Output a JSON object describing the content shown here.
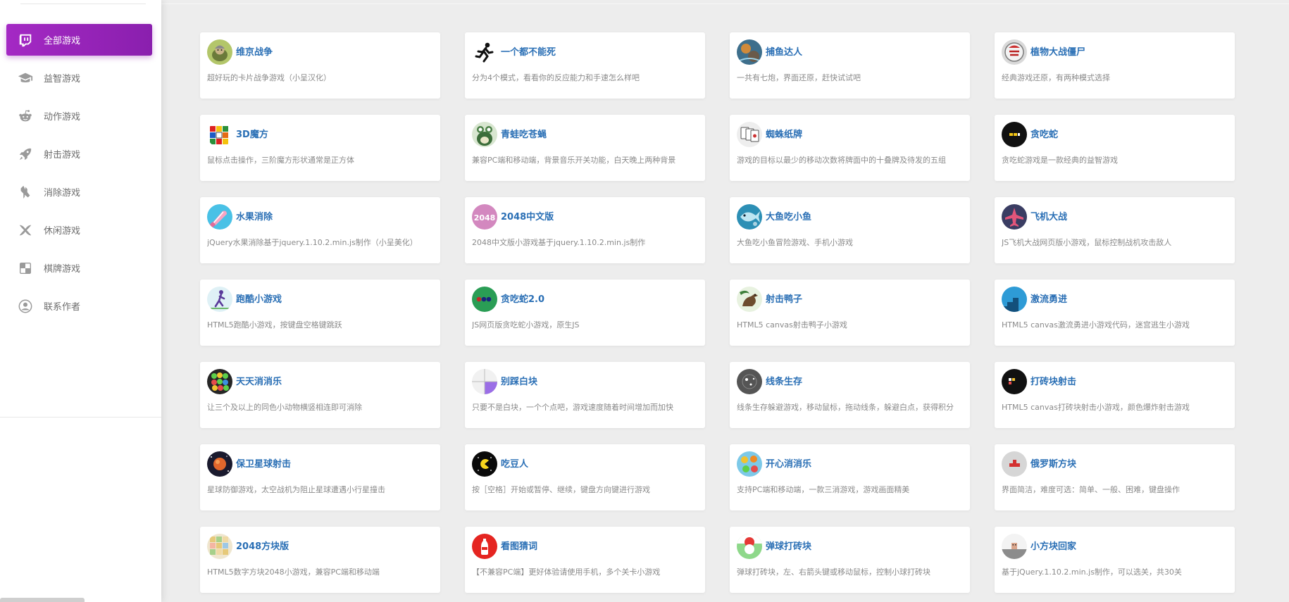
{
  "sidebar": {
    "items": [
      {
        "label": "全部游戏",
        "icon": "twitch-icon",
        "active": true
      },
      {
        "label": "益智游戏",
        "icon": "graduation-cap-icon",
        "active": false
      },
      {
        "label": "动作游戏",
        "icon": "reddit-icon",
        "active": false
      },
      {
        "label": "射击游戏",
        "icon": "rocket-icon",
        "active": false
      },
      {
        "label": "消除游戏",
        "icon": "lightning-icon",
        "active": false
      },
      {
        "label": "休闲游戏",
        "icon": "xbox-icon",
        "active": false
      },
      {
        "label": "棋牌游戏",
        "icon": "checkerboard-icon",
        "active": false
      },
      {
        "label": "联系作者",
        "icon": "user-circle-icon",
        "active": false
      }
    ],
    "accent_color": "#9b25bd"
  },
  "games": [
    {
      "title": "维京战争",
      "desc": "超好玩的卡片战争游戏（小呈汉化）",
      "icon": "viking-war-icon"
    },
    {
      "title": "一个都不能死",
      "desc": "分为4个模式，看看你的反应能力和手速怎么样吧",
      "icon": "running-man-icon"
    },
    {
      "title": "捕鱼达人",
      "desc": "一共有七炮，界面还原，赶快试试吧",
      "icon": "fishing-icon"
    },
    {
      "title": "植物大战僵尸",
      "desc": "经典游戏还原，有两种模式选择",
      "icon": "popcap-icon"
    },
    {
      "title": "3D魔方",
      "desc": "鼠标点击操作，三阶魔方形状通常是正方体",
      "icon": "rubiks-cube-icon"
    },
    {
      "title": "青蛙吃苍蝇",
      "desc": "兼容PC端和移动端，背景音乐开关功能，白天晚上两种背景",
      "icon": "frog-icon"
    },
    {
      "title": "蜘蛛纸牌",
      "desc": "游戏的目标以最少的移动次数将牌面中的十叠牌及待发的五组",
      "icon": "playing-cards-icon"
    },
    {
      "title": "贪吃蛇",
      "desc": "贪吃蛇游戏是一款经典的益智游戏",
      "icon": "snake-icon"
    },
    {
      "title": "水果消除",
      "desc": "jQuery水果消除基于jquery.1.10.2.min.js制作（小呈美化）",
      "icon": "fruit-icon"
    },
    {
      "title": "2048中文版",
      "desc": "2048中文版小游戏基于jquery.1.10.2.min.js制作",
      "icon": "game-2048-icon"
    },
    {
      "title": "大鱼吃小鱼",
      "desc": "大鱼吃小鱼冒险游戏、手机小游戏",
      "icon": "big-fish-icon"
    },
    {
      "title": "飞机大战",
      "desc": "JS飞机大战网页版小游戏，鼠标控制战机攻击敌人",
      "icon": "plane-icon"
    },
    {
      "title": "跑酷小游戏",
      "desc": "HTML5跑酷小游戏，按键盘空格键跳跃",
      "icon": "parkour-icon"
    },
    {
      "title": "贪吃蛇2.0",
      "desc": "JS网页版贪吃蛇小游戏，原生JS",
      "icon": "snake-dots-icon"
    },
    {
      "title": "射击鸭子",
      "desc": "HTML5 canvas射击鸭子小游戏",
      "icon": "duck-icon"
    },
    {
      "title": "激流勇进",
      "desc": "HTML5 canvas激流勇进小游戏代码，迷宫逃生小游戏",
      "icon": "stairs-icon"
    },
    {
      "title": "天天消消乐",
      "desc": "让三个及以上的同色小动物横竖相连即可消除",
      "icon": "animal-match-icon"
    },
    {
      "title": "别踩白块",
      "desc": "只要不是白块，一个个点吧，游戏速度随着时间增加而加快",
      "icon": "white-tiles-icon"
    },
    {
      "title": "线条生存",
      "desc": "线条生存躲避游戏，移动鼠标，拖动线条，躲避白点，获得积分",
      "icon": "line-survival-icon"
    },
    {
      "title": "打砖块射击",
      "desc": "HTML5 canvas打砖块射击小游戏，颜色爆炸射击游戏",
      "icon": "brick-shooter-icon"
    },
    {
      "title": "保卫星球射击",
      "desc": "星球防御游戏，太空战机为阻止星球遭遇小行星撞击",
      "icon": "planet-icon"
    },
    {
      "title": "吃豆人",
      "desc": "按［空格］开始或暂停、继续，键盘方向键进行游戏",
      "icon": "pacman-icon"
    },
    {
      "title": "开心消消乐",
      "desc": "支持PC端和移动端，一款三消游戏，游戏画面精美",
      "icon": "happy-match-icon"
    },
    {
      "title": "俄罗斯方块",
      "desc": "界面简洁，难度可选：简单、一般、困难，键盘操作",
      "icon": "tetris-icon"
    },
    {
      "title": "2048方块版",
      "desc": "HTML5数字方块2048小游戏，兼容PC端和移动端",
      "icon": "block-2048-icon"
    },
    {
      "title": "看图猜词",
      "desc": "【不兼容PC端】更好体验请使用手机，多个关卡小游戏",
      "icon": "guess-word-icon"
    },
    {
      "title": "弹球打砖块",
      "desc": "弹球打砖块，左、右箭头键或移动鼠标，控制小球打砖块",
      "icon": "pinball-icon"
    },
    {
      "title": "小方块回家",
      "desc": "基于jQuery.1.10.2.min.js制作，可以选关，共30关",
      "icon": "block-home-icon"
    }
  ],
  "colors": {
    "title": "#2a6fb5",
    "desc": "#8a8a8a",
    "background": "#ededed"
  }
}
